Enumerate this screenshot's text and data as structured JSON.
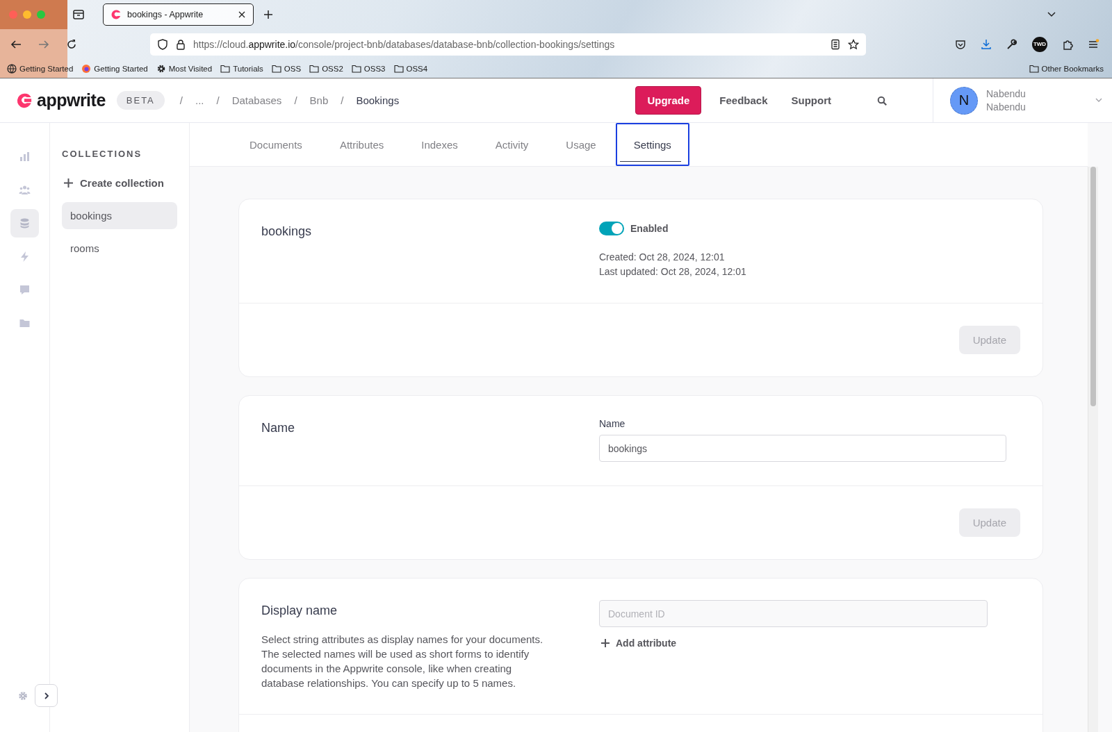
{
  "browser": {
    "tab_title": "bookings - Appwrite",
    "url": "https://cloud.**appwrite.io**/console/project-bnb/databases/database-bnb/collection-bookings/settings",
    "bookmarks": [
      {
        "kind": "globe",
        "label": "Getting Started"
      },
      {
        "kind": "firefox",
        "label": "Getting Started"
      },
      {
        "kind": "gear",
        "label": "Most Visited"
      },
      {
        "kind": "folder",
        "label": "Tutorials"
      },
      {
        "kind": "folder",
        "label": "OSS"
      },
      {
        "kind": "folder",
        "label": "OSS2"
      },
      {
        "kind": "folder",
        "label": "OSS3"
      },
      {
        "kind": "folder",
        "label": "OSS4"
      }
    ],
    "other_bookmarks": "Other Bookmarks",
    "profile_badge": "TWD"
  },
  "header": {
    "logo": "appwrite",
    "badge": "BETA",
    "separator": "/",
    "breadcrumbs": [
      {
        "label": "...",
        "selected": false
      },
      {
        "label": "Databases",
        "selected": false
      },
      {
        "label": "Bnb",
        "selected": false
      },
      {
        "label": "Bookings",
        "selected": true
      }
    ],
    "buttons": [
      {
        "kind": "primary",
        "label": "Upgrade"
      },
      {
        "kind": "text",
        "label": "Feedback"
      },
      {
        "kind": "text",
        "label": "Support"
      }
    ],
    "user": {
      "initial": "N",
      "name": "Nabendu",
      "email": "Nabendu"
    }
  },
  "rail": [
    {
      "kind": "chart",
      "selected": false
    },
    {
      "kind": "users",
      "selected": false
    },
    {
      "kind": "database",
      "selected": true
    },
    {
      "kind": "bolt",
      "selected": false
    },
    {
      "kind": "chat",
      "selected": false
    },
    {
      "kind": "folder",
      "selected": false
    }
  ],
  "collections": {
    "title": "COLLECTIONS",
    "create": "Create collection",
    "items": [
      {
        "label": "bookings",
        "selected": true
      },
      {
        "label": "rooms",
        "selected": false
      }
    ]
  },
  "tabs": [
    {
      "label": "Documents",
      "selected": false
    },
    {
      "label": "Attributes",
      "selected": false
    },
    {
      "label": "Indexes",
      "selected": false
    },
    {
      "label": "Activity",
      "selected": false
    },
    {
      "label": "Usage",
      "selected": false
    },
    {
      "label": "Settings",
      "selected": true
    }
  ],
  "cards": [
    {
      "kind": "status",
      "title": "bookings",
      "toggle": {
        "on": true,
        "label": "Enabled"
      },
      "created": "Created: Oct 28, 2024, 12:01",
      "updated": "Last updated: Oct 28, 2024, 12:01",
      "button": {
        "label": "Update",
        "disabled": true
      }
    },
    {
      "kind": "name",
      "title": "Name",
      "field_label": "Name",
      "value": "bookings",
      "button": {
        "label": "Update",
        "disabled": true
      }
    },
    {
      "kind": "display",
      "title": "Display name",
      "description": "Select string attributes as display names for your documents. The selected names will be used as short forms to identify documents in the Appwrite console, like when creating database relationships. You can specify up to 5 names.",
      "placeholder": "Document ID",
      "add": "Add attribute"
    }
  ]
}
